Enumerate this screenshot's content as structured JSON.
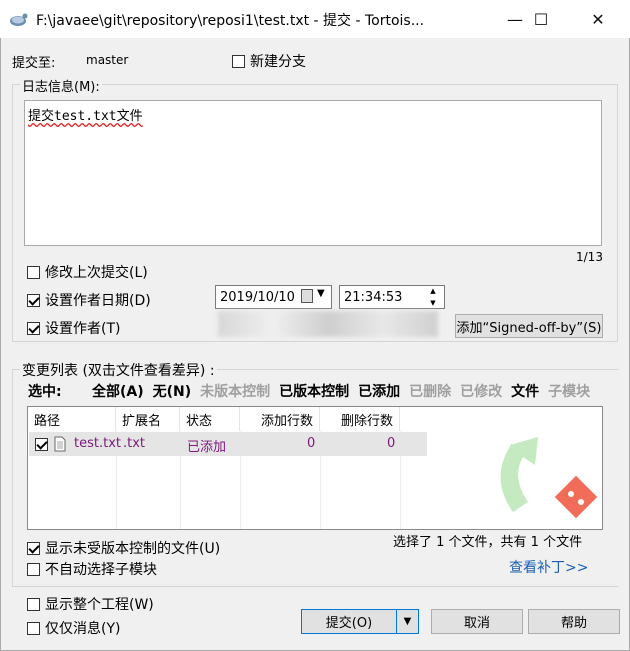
{
  "window": {
    "title": "F:\\javaee\\git\\repository\\reposi1\\test.txt - 提交 - Tortois...",
    "min_label": "—",
    "max_label": "☐",
    "close_label": "✕"
  },
  "commit_to": {
    "label": "提交至:",
    "branch": "master",
    "new_branch_label": "新建分支"
  },
  "message": {
    "group_label": "日志信息(M):",
    "text": "提交test.txt文件",
    "counter": "1/13"
  },
  "options": {
    "amend_label": "修改上次提交(L)",
    "set_date_label": "设置作者日期(D)",
    "date_value": "2019/10/10",
    "time_value": "21:34:53",
    "set_author_label": "设置作者(T)",
    "signed_off_label": "添加“Signed-off-by”(S)"
  },
  "changes": {
    "group_label": "变更列表 (双击文件查看差异) :",
    "select_label": "选中:",
    "filters": [
      {
        "label": "全部(A)",
        "enabled": true
      },
      {
        "label": "无(N)",
        "enabled": true
      },
      {
        "label": "未版本控制",
        "enabled": false
      },
      {
        "label": "已版本控制",
        "enabled": true
      },
      {
        "label": "已添加",
        "enabled": true
      },
      {
        "label": "已删除",
        "enabled": false
      },
      {
        "label": "已修改",
        "enabled": false
      },
      {
        "label": "文件",
        "enabled": true
      },
      {
        "label": "子模块",
        "enabled": false
      }
    ],
    "columns": [
      "路径",
      "扩展名",
      "状态",
      "添加行数",
      "删除行数"
    ],
    "rows": [
      {
        "path": "test.txt",
        "ext": ".txt",
        "status": "已添加",
        "added": "0",
        "deleted": "0",
        "checked": true
      }
    ],
    "show_unversioned_label": "显示未受版本控制的文件(U)",
    "no_autoselect_label": "不自动选择子模块",
    "summary": "选择了 1 个文件，共有 1 个文件",
    "view_patch_label": "查看补丁>>"
  },
  "footer": {
    "whole_project_label": "显示整个工程(W)",
    "message_only_label": "仅仅消息(Y)",
    "commit_label": "提交(O)",
    "cancel_label": "取消",
    "help_label": "帮助"
  },
  "colors": {
    "accent": "#0078d7",
    "added": "#7a1a7a",
    "link": "#1a5fb4"
  }
}
